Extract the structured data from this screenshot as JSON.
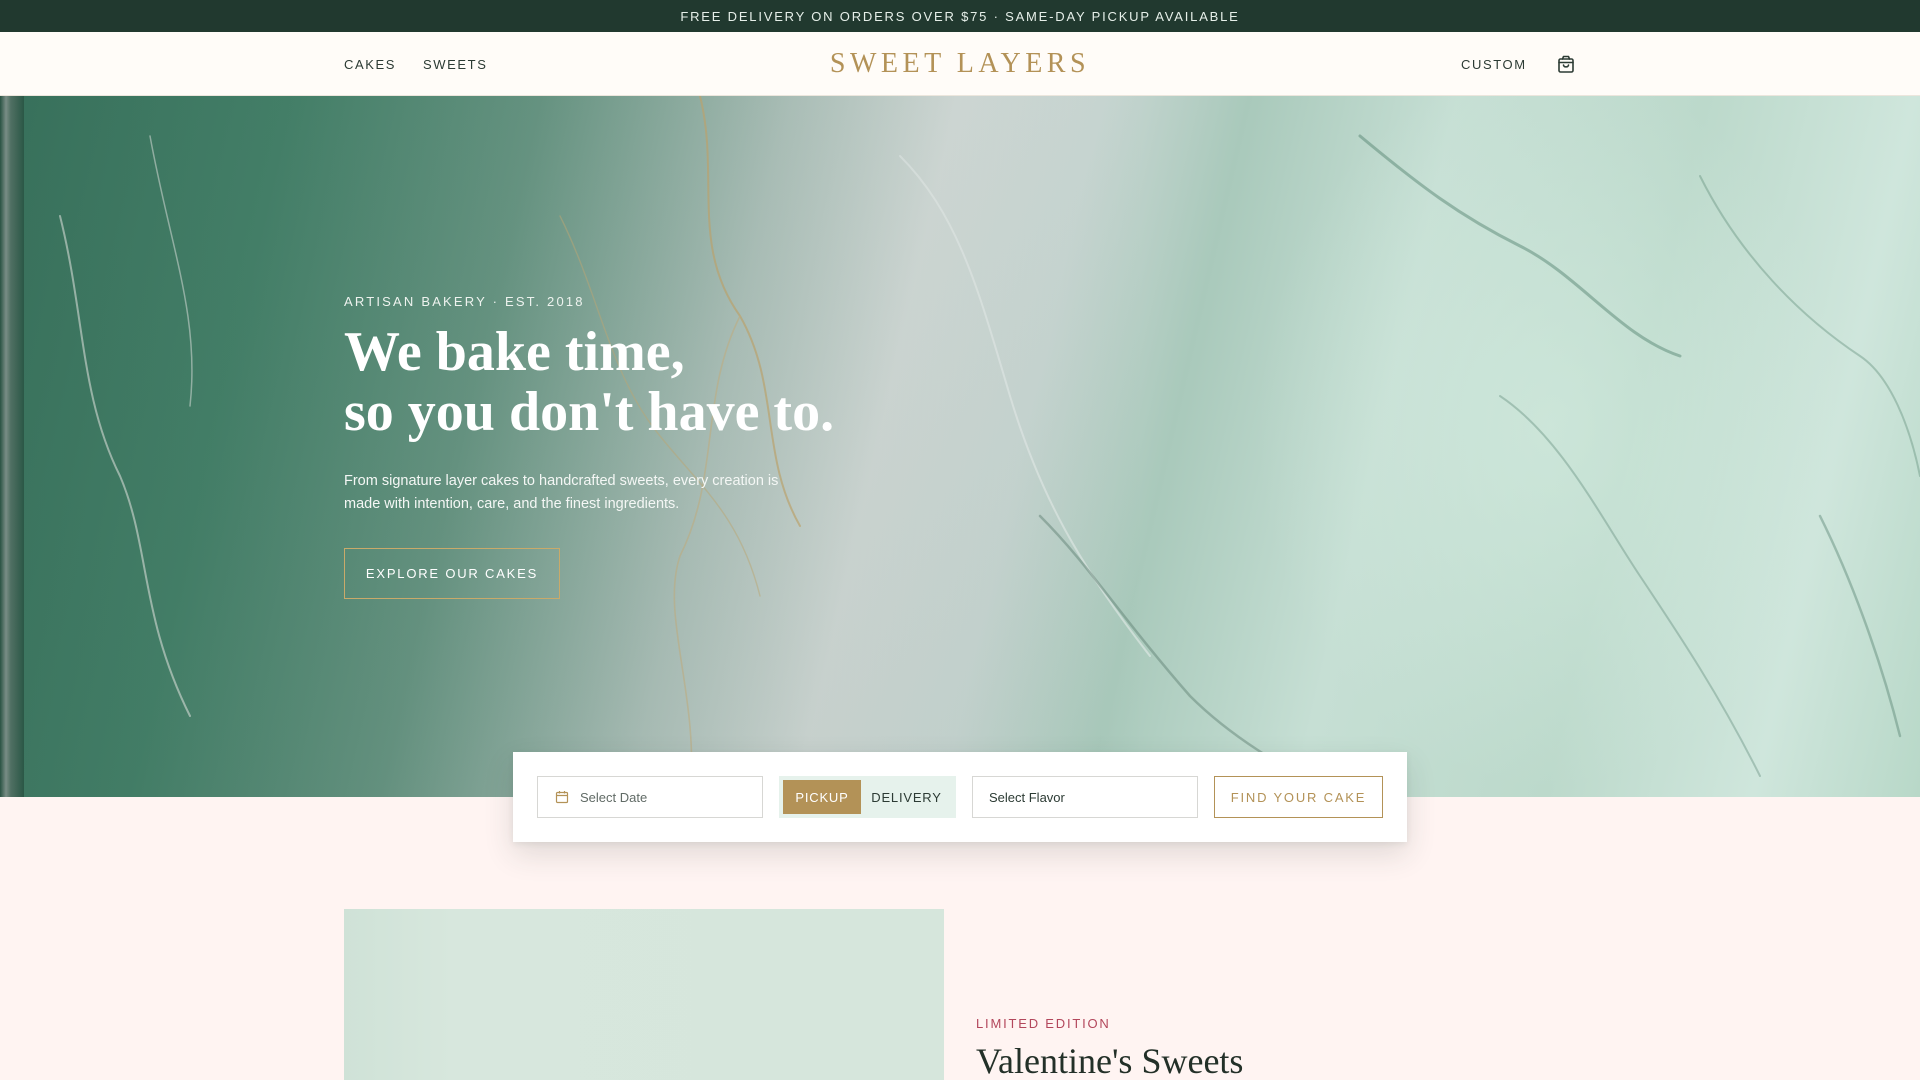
{
  "announcement": "FREE DELIVERY ON ORDERS OVER $75 · SAME-DAY PICKUP AVAILABLE",
  "header": {
    "nav_left": [
      "CAKES",
      "SWEETS"
    ],
    "logo": "SWEET LAYERS",
    "nav_right": [
      "CUSTOM"
    ],
    "cart_icon": "shopping-bag-icon"
  },
  "hero": {
    "eyebrow": "ARTISAN BAKERY · EST. 2018",
    "headline_line1": "We bake time,",
    "headline_line2": "so you don't have to.",
    "subtext": "From signature layer cakes to handcrafted sweets, every creation is made with intention, care, and the finest ingredients.",
    "cta": "EXPLORE OUR CAKES"
  },
  "finder": {
    "date_placeholder": "Select Date",
    "date_icon": "calendar-icon",
    "modes": [
      "PICKUP",
      "DELIVERY"
    ],
    "selected_mode": "PICKUP",
    "flavor_placeholder": "Select Flavor",
    "submit": "FIND YOUR CAKE"
  },
  "promo": {
    "eyebrow": "LIMITED EDITION",
    "title": "Valentine's Sweets"
  },
  "colors": {
    "top_bar": "#21392f",
    "gold": "#b39257",
    "page_bg": "#fff4f2",
    "accent_red": "#b3475c",
    "toggle_bg": "#e6f2ec"
  }
}
